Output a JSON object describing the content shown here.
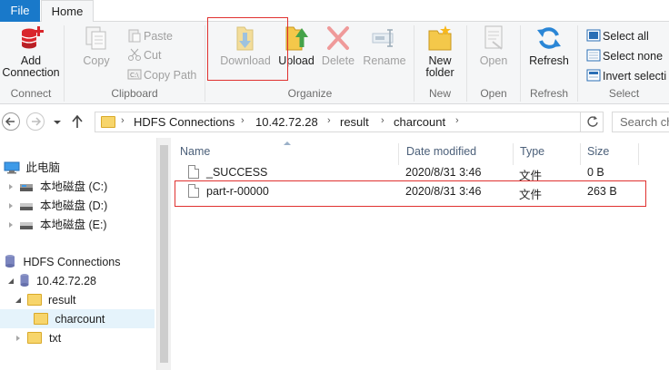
{
  "tabs": {
    "file": "File",
    "home": "Home"
  },
  "ribbon": {
    "connect": {
      "add_connection": "Add\nConnection",
      "label": "Connect"
    },
    "clipboard": {
      "copy": "Copy",
      "paste": "Paste",
      "cut": "Cut",
      "copy_path": "Copy Path",
      "label": "Clipboard"
    },
    "organize": {
      "download": "Download",
      "upload": "Upload",
      "delete": "Delete",
      "rename": "Rename",
      "label": "Organize"
    },
    "new": {
      "new_folder": "New\nfolder",
      "label": "New"
    },
    "open": {
      "open": "Open",
      "label": "Open"
    },
    "refresh": {
      "refresh": "Refresh",
      "label": "Refresh"
    },
    "select": {
      "select_all": "Select all",
      "select_none": "Select none",
      "invert_selection": "Invert selecti",
      "label": "Select"
    }
  },
  "address": {
    "crumbs": [
      "HDFS Connections",
      "10.42.72.28",
      "result",
      "charcount"
    ],
    "search_placeholder": "Search ch"
  },
  "tree": {
    "this_pc": "此电脑",
    "drive_c": "本地磁盘 (C:)",
    "drive_d": "本地磁盘 (D:)",
    "drive_e": "本地磁盘 (E:)",
    "hdfs_connections": "HDFS Connections",
    "host": "10.42.72.28",
    "result": "result",
    "charcount": "charcount",
    "txt": "txt"
  },
  "columns": {
    "name": "Name",
    "date_modified": "Date modified",
    "type": "Type",
    "size": "Size"
  },
  "files": [
    {
      "name": "_SUCCESS",
      "date": "2020/8/31 3:46",
      "type": "文件",
      "size": "0 B"
    },
    {
      "name": "part-r-00000",
      "date": "2020/8/31 3:46",
      "type": "文件",
      "size": "263 B"
    }
  ],
  "colors": {
    "accent": "#1979ca",
    "highlight": "#e0312f",
    "selection": "#e5f3fb"
  }
}
